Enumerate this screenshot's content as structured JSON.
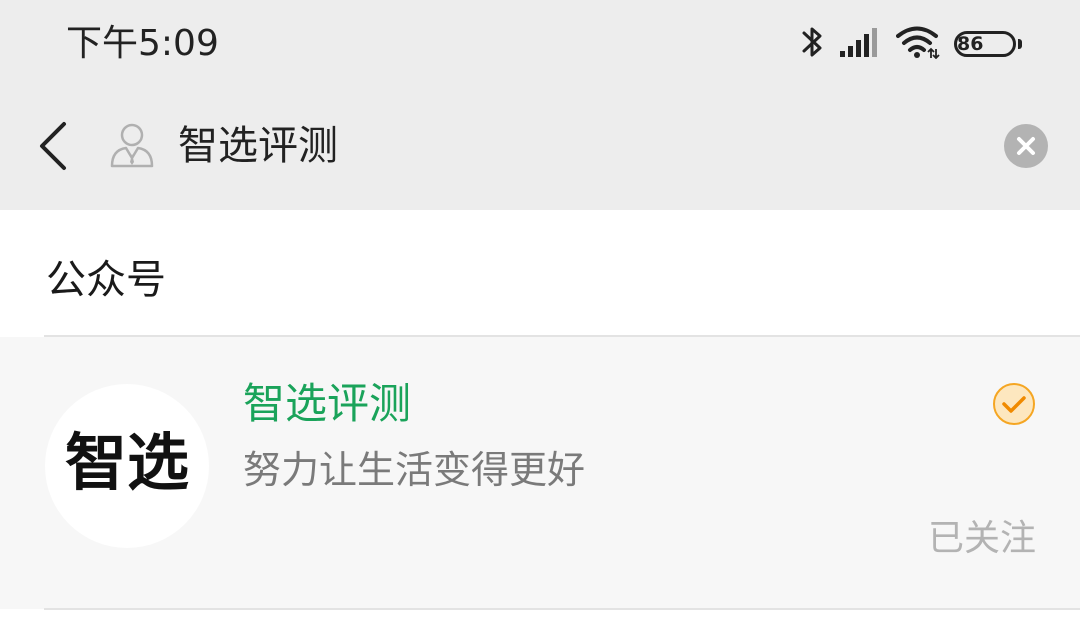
{
  "status_bar": {
    "time": "下午5:09",
    "battery": "86",
    "icons": [
      "bluetooth-icon",
      "signal-icon",
      "wifi-icon",
      "battery-icon"
    ]
  },
  "search": {
    "query": "智选评测",
    "back_icon": "chevron-left-icon",
    "contact_icon": "contact-icon",
    "clear_icon": "clear-icon"
  },
  "section": {
    "title": "公众号"
  },
  "results": [
    {
      "avatar_text": "智选",
      "name": "智选评测",
      "description": "努力让生活变得更好",
      "status": "已关注",
      "badge_icon": "verified-check-icon"
    }
  ],
  "colors": {
    "header_bg": "#ededed",
    "accent_green": "#1aa35a",
    "badge_orange": "#f5a623",
    "item_bg": "#f7f7f7"
  }
}
